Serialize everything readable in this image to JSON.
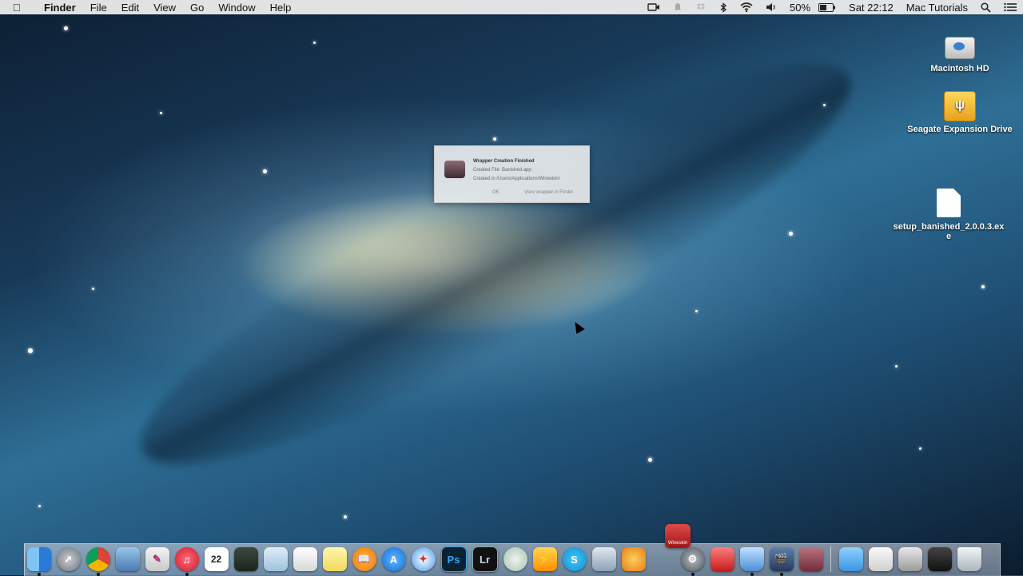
{
  "menubar": {
    "app_name": "Finder",
    "menus": [
      "File",
      "Edit",
      "View",
      "Go",
      "Window",
      "Help"
    ],
    "battery": "50%",
    "clock": "Sat 22:12",
    "user": "Mac Tutorials"
  },
  "desktop_icons": {
    "hd": "Macintosh HD",
    "drive": "Seagate Expansion Drive",
    "file": "setup_banished_2.0.0.3.ex",
    "file_line2": "e"
  },
  "notification": {
    "title": "Wrapper Creation Finished",
    "line1": "Created File: Banished.app",
    "line2": "Created in /Users/Applications/Wineskin/",
    "button_ok": "OK",
    "button_view": "View wrapper in Finder"
  },
  "dock": {
    "wineskin_label": "Wineskin",
    "ps_label": "Ps",
    "lr_label": "Lr",
    "skype_label": "S",
    "calendar_day": "22"
  },
  "colors": {
    "menubar_bg": "#ececec",
    "accent_blue": "#3a7fd1"
  }
}
